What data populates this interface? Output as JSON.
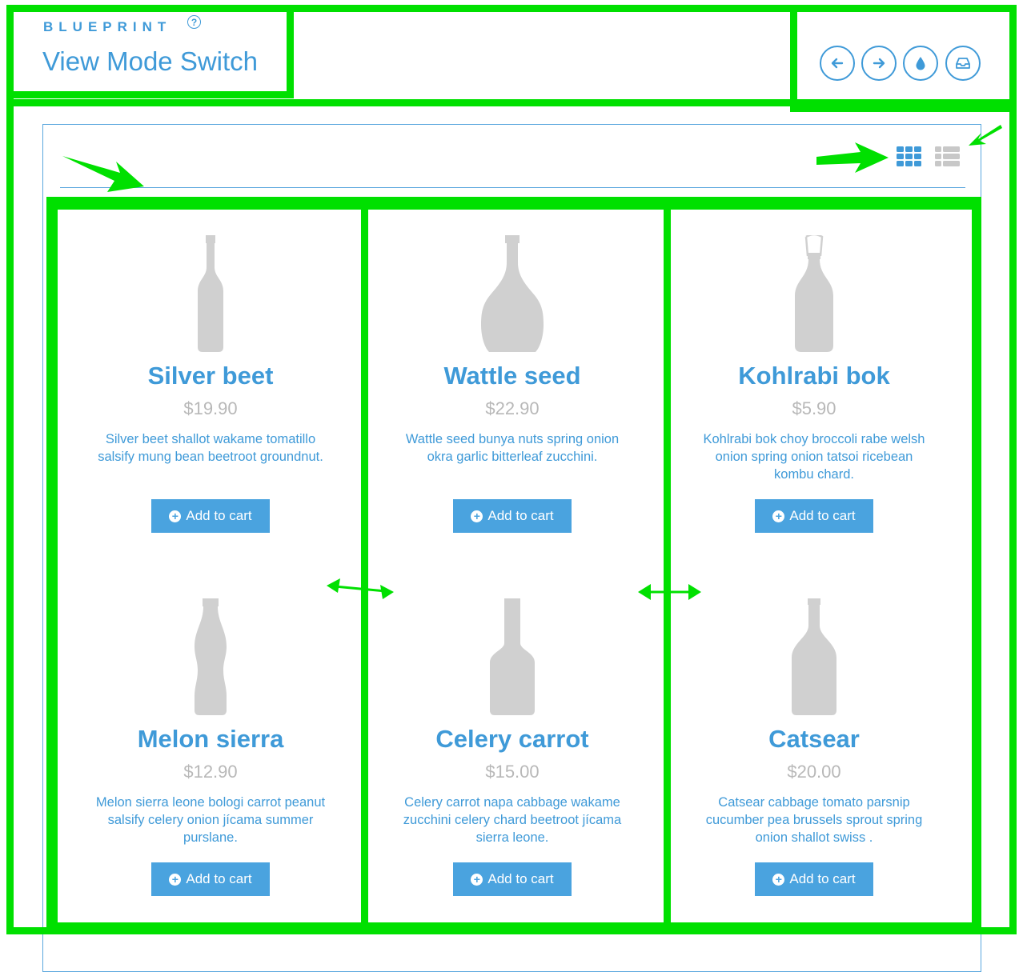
{
  "header": {
    "brand": "BLUEPRINT",
    "help_glyph": "?",
    "title": "View Mode Switch",
    "nav_icons": [
      "arrow-left-icon",
      "arrow-right-icon",
      "water-drop-icon",
      "inbox-icon"
    ]
  },
  "view_switch": {
    "active": "grid",
    "icons": [
      "grid-view-icon",
      "list-view-icon"
    ]
  },
  "products": [
    {
      "name": "Silver beet",
      "price": "$19.90",
      "description": "Silver beet shallot wakame tomatillo salsify mung bean beetroot groundnut.",
      "button": "Add to cart"
    },
    {
      "name": "Wattle seed",
      "price": "$22.90",
      "description": "Wattle seed bunya nuts spring onion okra garlic bitterleaf zucchini.",
      "button": "Add to cart"
    },
    {
      "name": "Kohlrabi bok",
      "price": "$5.90",
      "description": "Kohlrabi bok choy broccoli rabe welsh onion spring onion tatsoi ricebean kombu chard.",
      "button": "Add to cart"
    },
    {
      "name": "Melon sierra",
      "price": "$12.90",
      "description": "Melon sierra leone bologi carrot peanut salsify celery onion jícama summer purslane.",
      "button": "Add to cart"
    },
    {
      "name": "Celery carrot",
      "price": "$15.00",
      "description": "Celery carrot napa cabbage wakame zucchini celery chard beetroot jícama sierra leone.",
      "button": "Add to cart"
    },
    {
      "name": "Catsear",
      "price": "$20.00",
      "description": "Catsear cabbage tomato parsnip cucumber pea brussels sprout spring onion shallot swiss .",
      "button": "Add to cart"
    }
  ],
  "colors": {
    "accent": "#3f9ad8",
    "button": "#4aa3df",
    "price": "#b8b8b8",
    "annotation": "#00e000",
    "bottle": "#d0d0d0"
  }
}
